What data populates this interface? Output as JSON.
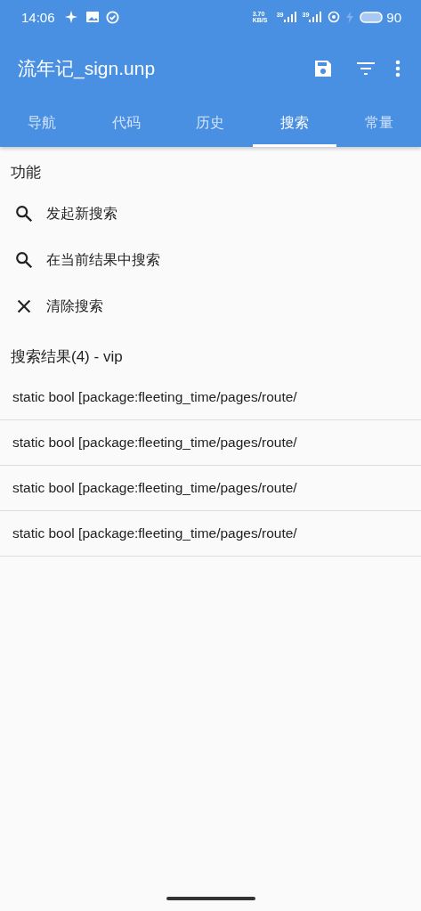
{
  "status_bar": {
    "time": "14:06",
    "net_speed": "3.70 KB/S",
    "signal_1": "39",
    "signal_2": "39",
    "battery": "90"
  },
  "app_bar": {
    "title": "流年记_sign.unp"
  },
  "tabs": [
    {
      "label": "导航",
      "selected": false
    },
    {
      "label": "代码",
      "selected": false
    },
    {
      "label": "历史",
      "selected": false
    },
    {
      "label": "搜索",
      "selected": true
    },
    {
      "label": "常量",
      "selected": false
    }
  ],
  "functions": {
    "heading": "功能",
    "items": [
      {
        "kind": "search",
        "label": "发起新搜索"
      },
      {
        "kind": "search",
        "label": "在当前结果中搜索"
      },
      {
        "kind": "clear",
        "label": "清除搜索"
      }
    ]
  },
  "results": {
    "heading": "搜索结果(4) - vip",
    "rows": [
      "static bool [package:fleeting_time/pages/route/",
      "static bool [package:fleeting_time/pages/route/",
      "static bool [package:fleeting_time/pages/route/",
      "static bool [package:fleeting_time/pages/route/"
    ]
  }
}
